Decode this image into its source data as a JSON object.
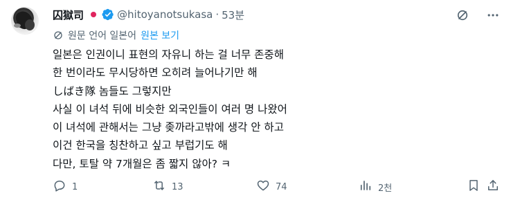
{
  "author": {
    "name": "囚獄司",
    "handle": "@hitoyanotsukasa",
    "separator": "·",
    "time": "53분"
  },
  "translation": {
    "source_label": "원문 언어 일본어",
    "show_original": "원본 보기"
  },
  "tweet_lines": [
    "일본은 인권이니 표현의 자유니 하는 걸 너무 존중해",
    "한 번이라도 무시당하면 오히려 늘어나기만 해",
    "しばき隊 놈들도 그렇지만",
    "사실 이 녀석 뒤에 비슷한 외국인들이 여러 명 나왔어",
    "이 녀석에 관해서는 그냥 좆까라고밖에 생각 안 하고",
    "이건 한국을 칭찬하고 싶고 부럽기도 해",
    "다만, 토탈 약 7개월은 좀 짧지 않아? ㅋ"
  ],
  "actions": {
    "replies": "1",
    "retweets": "13",
    "likes": "74",
    "views": "2천"
  },
  "icons": {
    "flag": "japan-flag-icon",
    "verified": "verified-badge-icon",
    "grok": "grok-icon",
    "more": "more-options-icon",
    "translate": "translate-globe-icon",
    "reply": "reply-icon",
    "retweet": "retweet-icon",
    "like": "heart-icon",
    "views": "views-icon",
    "bookmark": "bookmark-icon",
    "share": "share-icon"
  },
  "colors": {
    "text": "#0f1419",
    "secondary": "#536471",
    "link": "#1d9bf0",
    "verified": "#1d9bf0",
    "flag_red": "#e0245e"
  }
}
